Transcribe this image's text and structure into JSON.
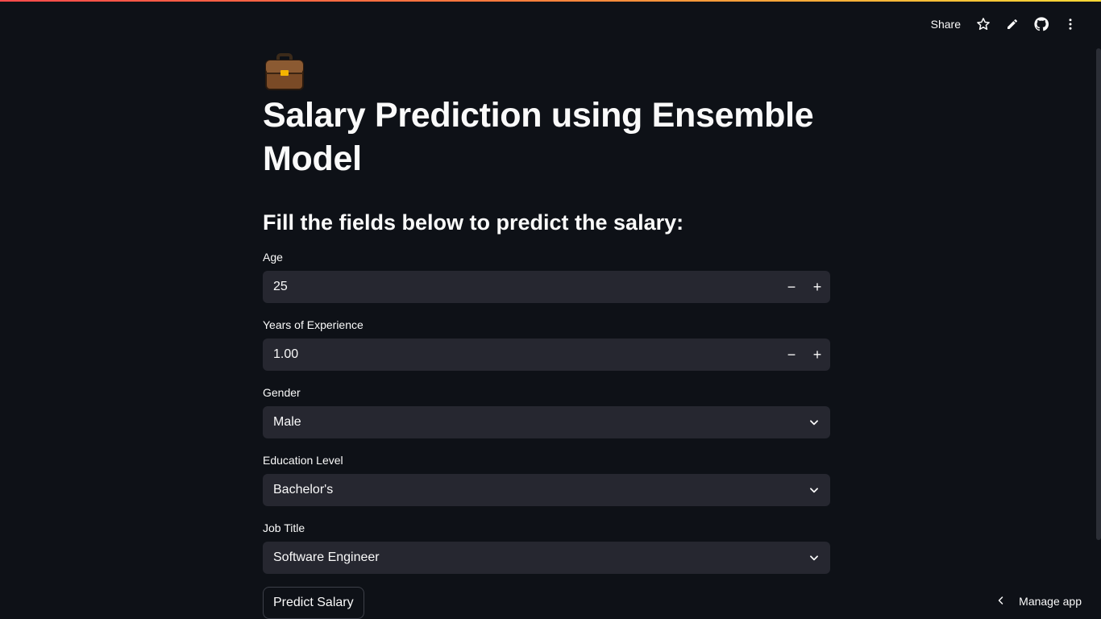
{
  "toolbar": {
    "share_label": "Share",
    "icons": [
      "star-icon",
      "pencil-icon",
      "github-icon",
      "more-vert-icon"
    ]
  },
  "main": {
    "title_emoji": "briefcase-icon",
    "title": "Salary Prediction using Ensemble Model",
    "subtitle": "Fill the fields below to predict the salary:",
    "fields": {
      "age": {
        "label": "Age",
        "value": "25",
        "decrement": "−",
        "increment": "+"
      },
      "experience": {
        "label": "Years of Experience",
        "value": "1.00",
        "decrement": "−",
        "increment": "+"
      },
      "gender": {
        "label": "Gender",
        "selected": "Male"
      },
      "education": {
        "label": "Education Level",
        "selected": "Bachelor's"
      },
      "job_title": {
        "label": "Job Title",
        "selected": "Software Engineer"
      }
    },
    "predict_button": "Predict Salary"
  },
  "footer": {
    "manage_app": "Manage app"
  },
  "colors": {
    "background": "#0e1117",
    "input_bg": "#262730",
    "text": "#fafafa",
    "accent_gradient_start": "#ff4b4b",
    "accent_gradient_end": "#fdd835"
  }
}
